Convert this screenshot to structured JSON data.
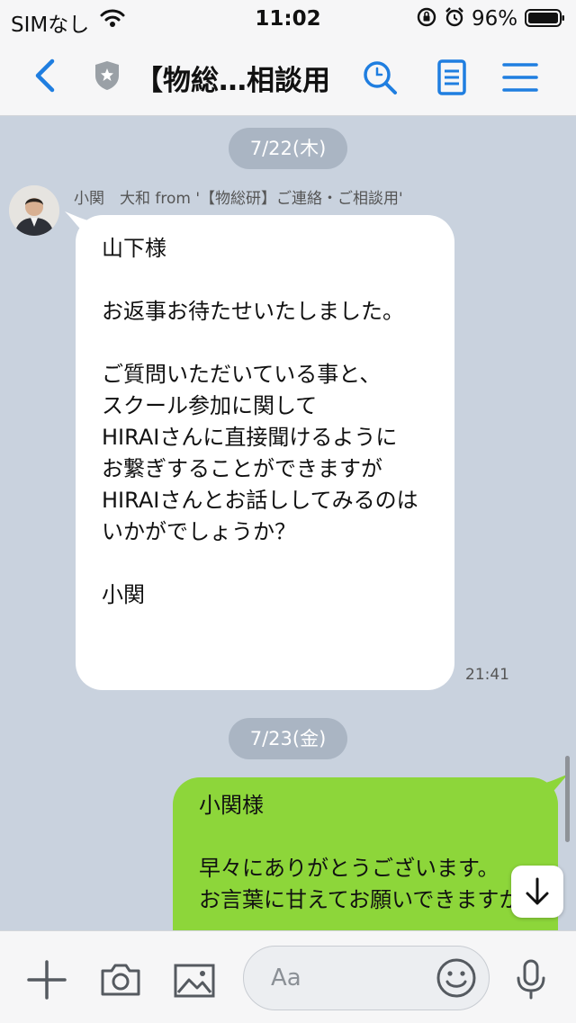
{
  "status_bar": {
    "carrier": "SIMなし",
    "time": "11:02",
    "battery_pct": "96%"
  },
  "navbar": {
    "title": "【物総…相談用"
  },
  "chat": {
    "dates": [
      "7/22(木)",
      "7/23(金)"
    ],
    "incoming": {
      "sender": "小関　大和 from '【物総研】ご連絡・ご相談用'",
      "text": "山下様\n\nお返事お待たせいたしました。\n\nご質問いただいている事と、\nスクール参加に関して\nHIRAIさんに直接聞けるように\nお繋ぎすることができますが\nHIRAIさんとお話ししてみるのは\nいかがでしょうか？\n\n小関",
      "time": "21:41"
    },
    "outgoing": {
      "text": "小関様\n\n早々にありがとうございます。\nお言葉に甘えてお願いできますか"
    }
  },
  "input_bar": {
    "placeholder": "Aa"
  },
  "colors": {
    "accent": "#1f7ee0",
    "chat_background": "#c9d2de",
    "outgoing_bubble": "#8dd63a",
    "incoming_bubble": "#ffffff",
    "date_pill": "#aab5c3"
  }
}
